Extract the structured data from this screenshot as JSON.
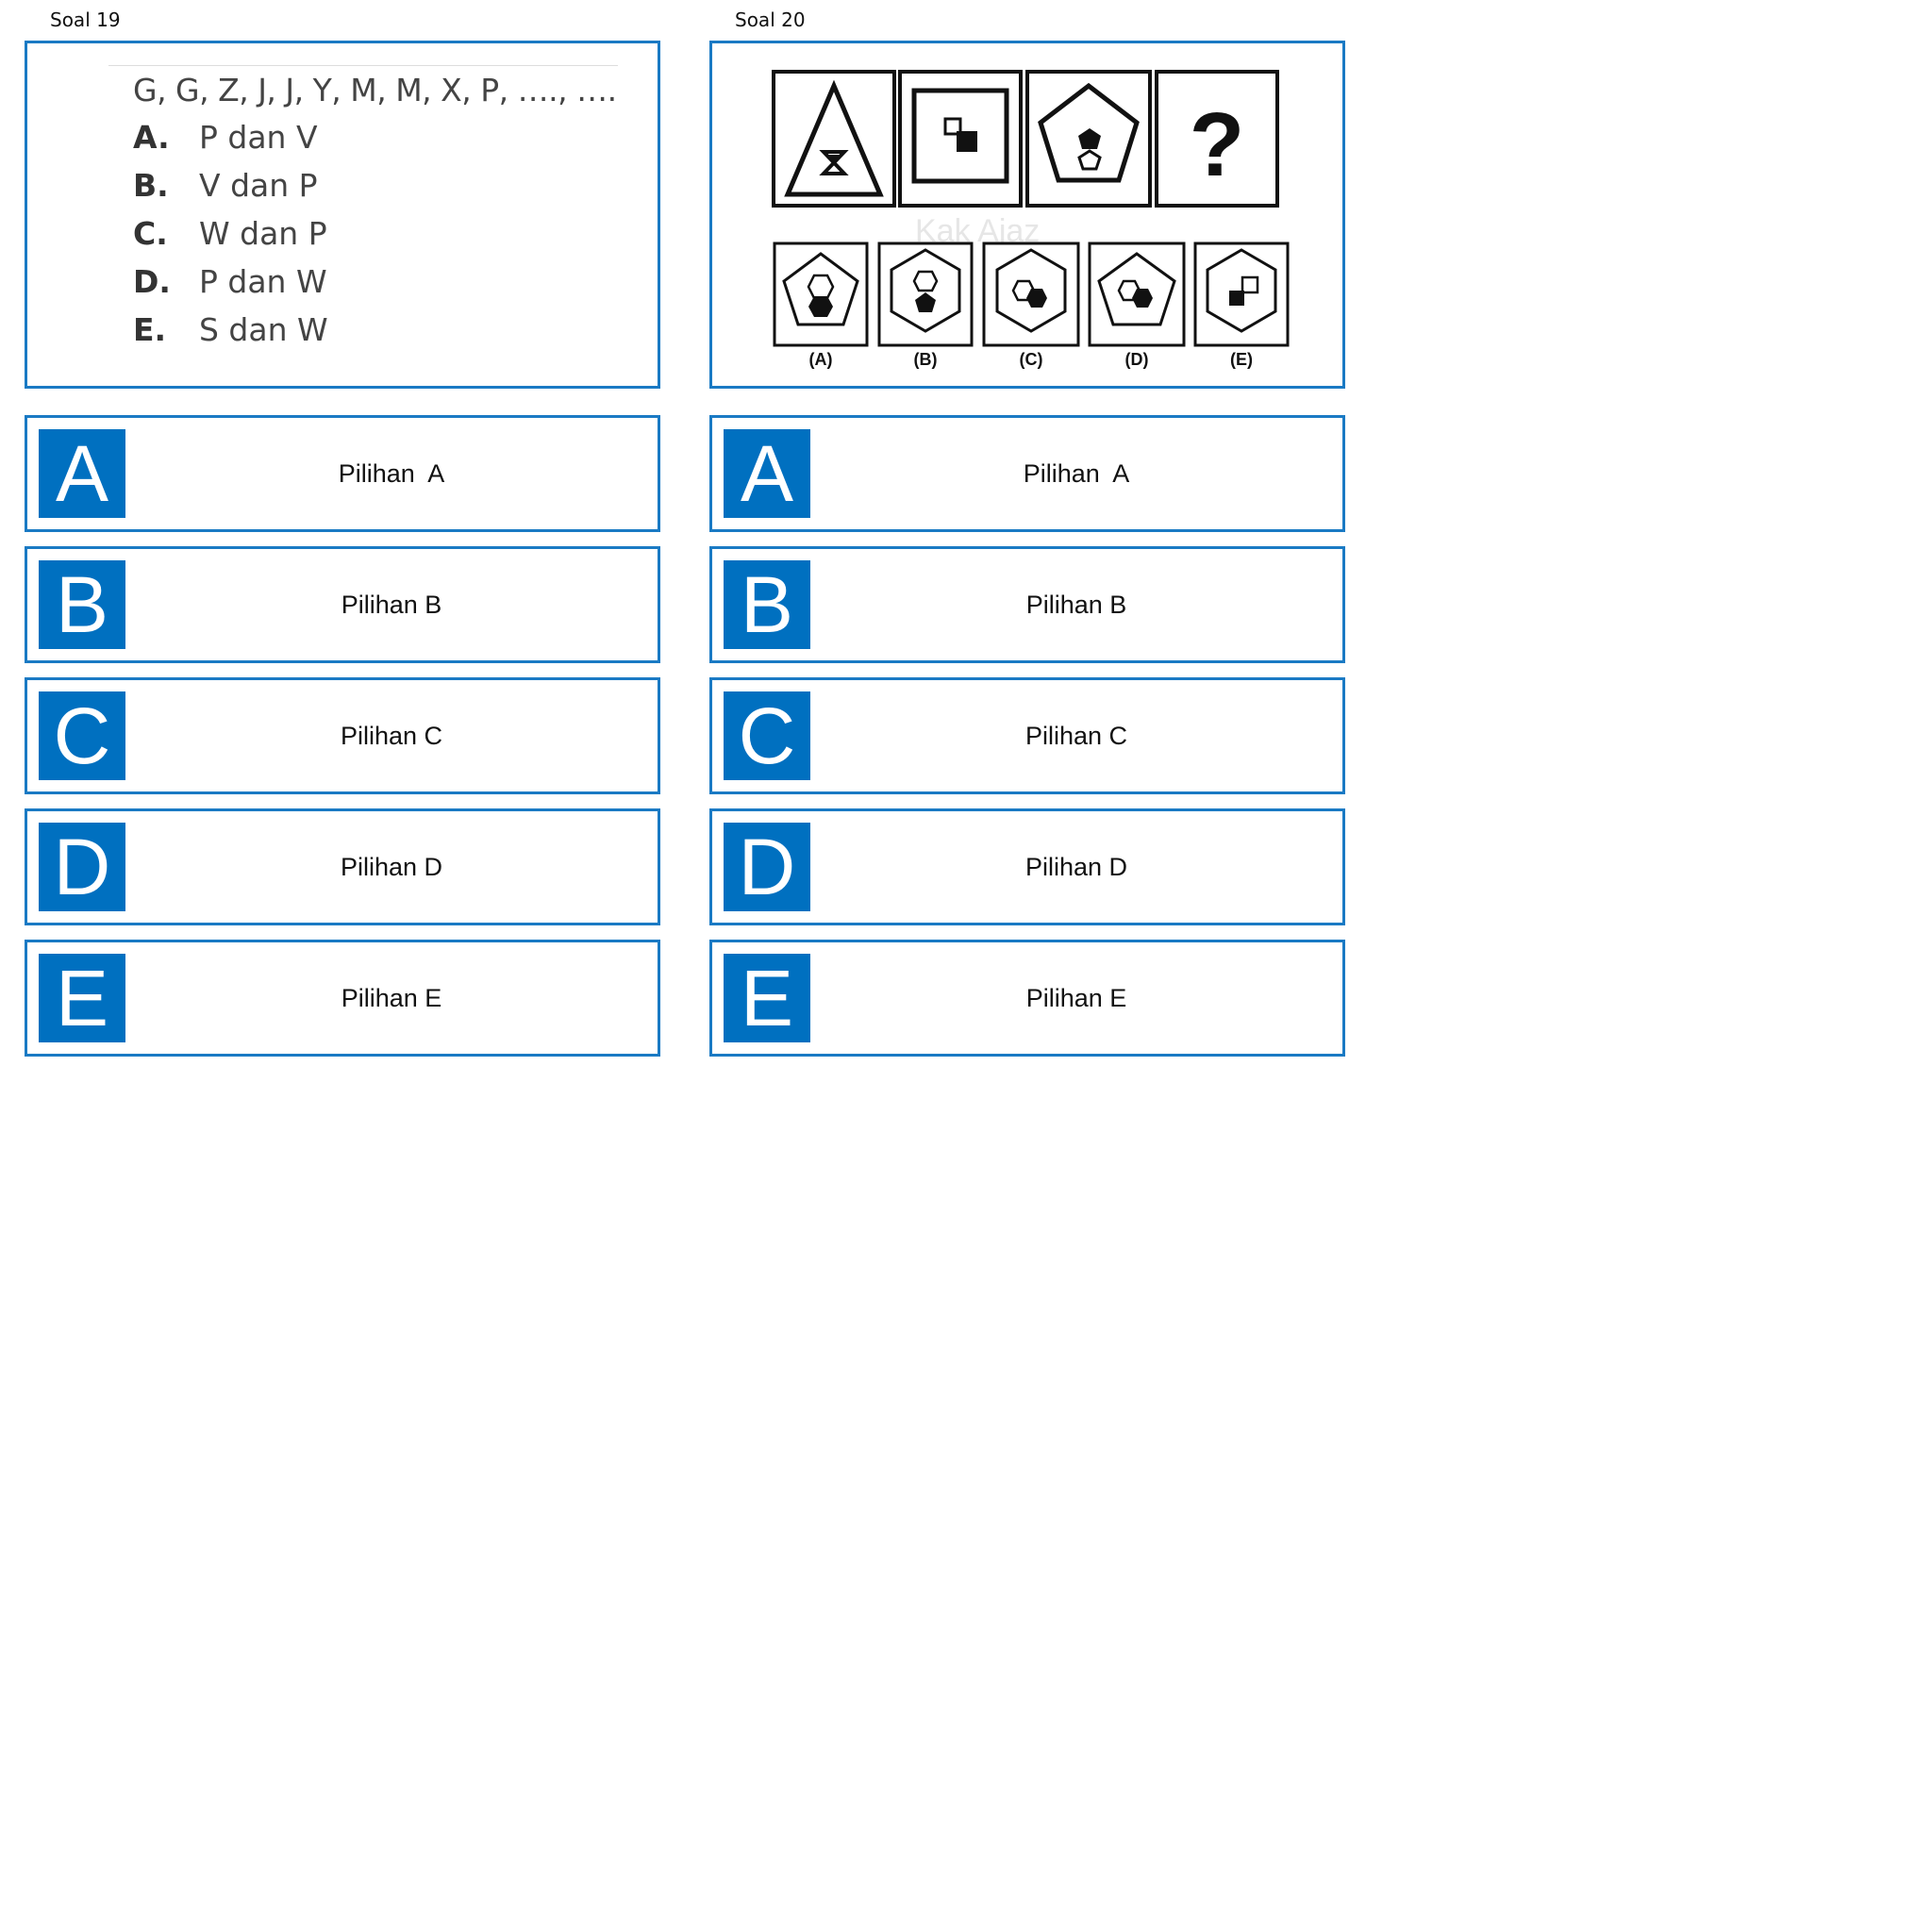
{
  "soal19": {
    "title": "Soal 19",
    "sequence": "G, G, Z, J, J, Y, M, M, X, P, …., ….",
    "choices": [
      {
        "key": "A.",
        "text": "P dan V"
      },
      {
        "key": "B.",
        "text": "V dan P"
      },
      {
        "key": "C.",
        "text": "W dan P"
      },
      {
        "key": "D.",
        "text": "P dan W"
      },
      {
        "key": "E.",
        "text": "S dan W"
      }
    ],
    "options": [
      {
        "letter": "A",
        "label": "Pilihan  A"
      },
      {
        "letter": "B",
        "label": "Pilihan B"
      },
      {
        "letter": "C",
        "label": "Pilihan C"
      },
      {
        "letter": "D",
        "label": "Pilihan D"
      },
      {
        "letter": "E",
        "label": "Pilihan E"
      }
    ]
  },
  "soal20": {
    "title": "Soal 20",
    "question_mark": "?",
    "watermark": "Kak Ajaz",
    "answer_labels": [
      "(A)",
      "(B)",
      "(C)",
      "(D)",
      "(E)"
    ],
    "options": [
      {
        "letter": "A",
        "label": "Pilihan  A"
      },
      {
        "letter": "B",
        "label": "Pilihan B"
      },
      {
        "letter": "C",
        "label": "Pilihan C"
      },
      {
        "letter": "D",
        "label": "Pilihan D"
      },
      {
        "letter": "E",
        "label": "Pilihan E"
      }
    ]
  },
  "colors": {
    "accent": "#0070c0",
    "border": "#1a7ac4"
  }
}
